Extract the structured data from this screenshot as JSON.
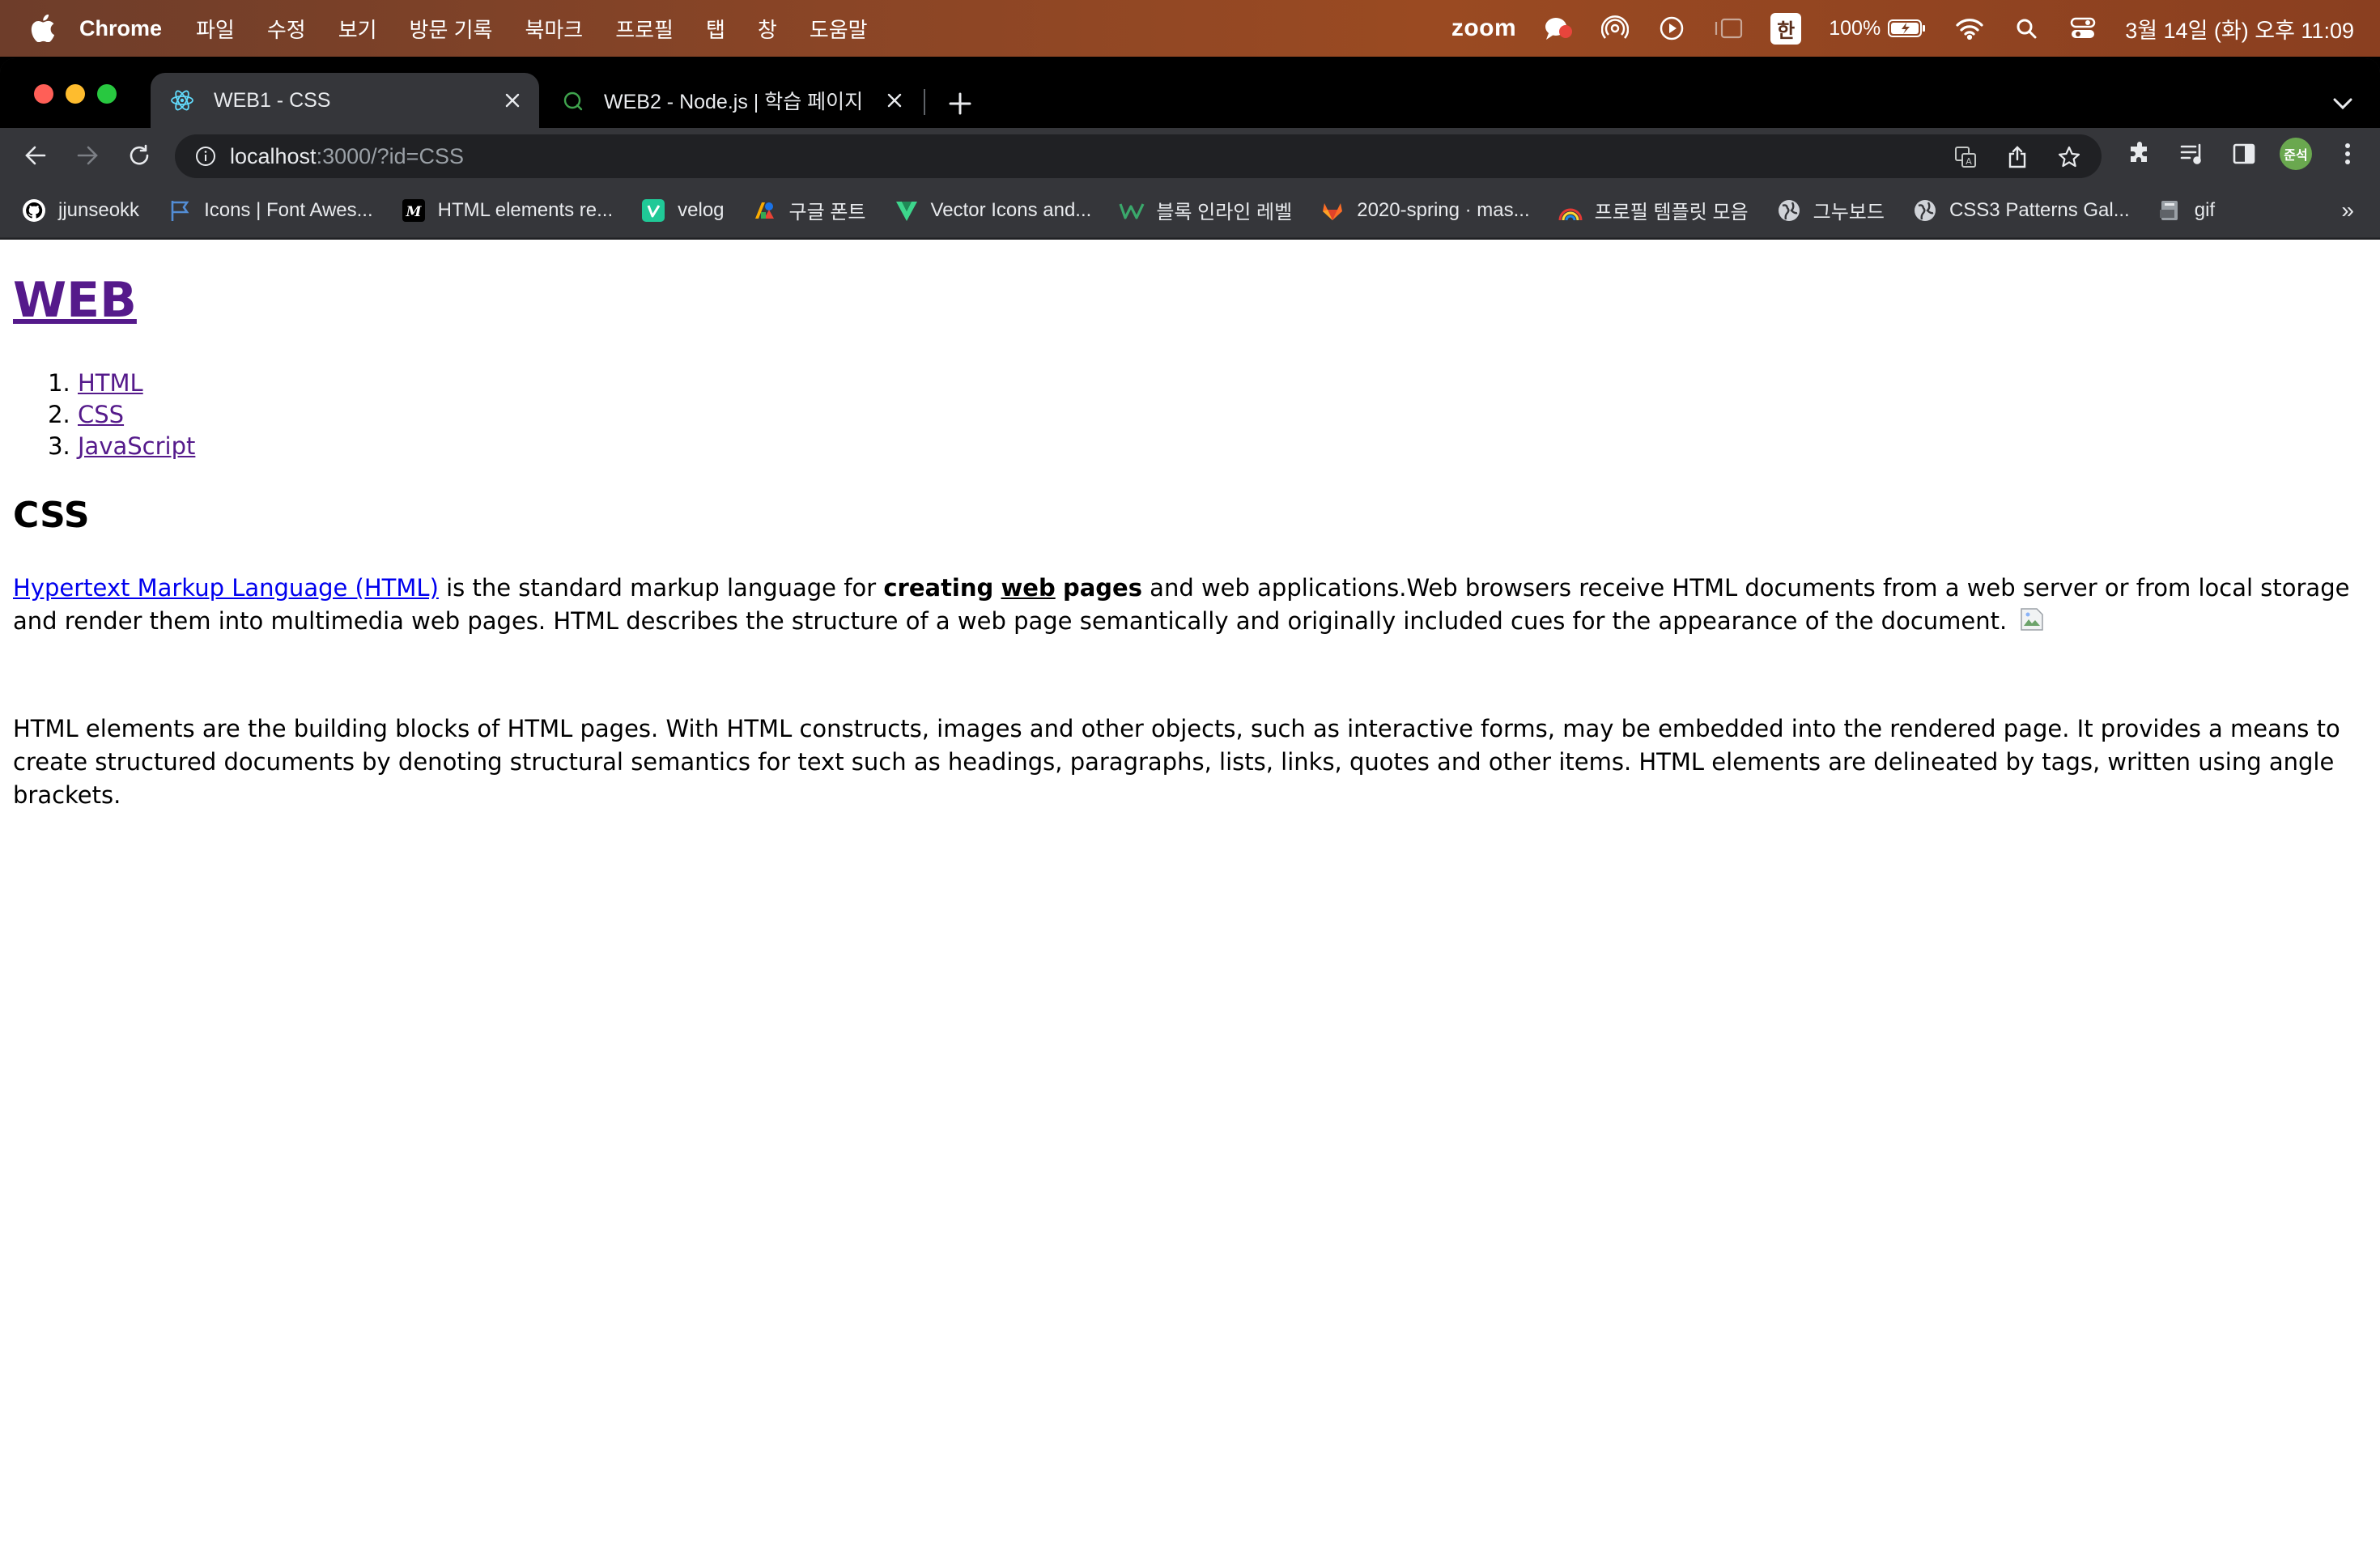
{
  "menubar": {
    "app_name": "Chrome",
    "menus": [
      "파일",
      "수정",
      "보기",
      "방문 기록",
      "북마크",
      "프로필",
      "탭",
      "창",
      "도움말"
    ],
    "zoom_label": "zoom",
    "input_method": "한",
    "battery_percent": "100%",
    "clock": "3월 14일 (화) 오후 11:09"
  },
  "tabs": [
    {
      "title": "WEB1 - CSS",
      "active": true
    },
    {
      "title": "WEB2 - Node.js | 학습 페이지",
      "active": false
    }
  ],
  "omnibox": {
    "host": "localhost",
    "path": ":3000/?id=CSS"
  },
  "avatar_label": "준석",
  "bookmarks": [
    {
      "label": "jjunseokk",
      "icon": "github-icon"
    },
    {
      "label": "Icons | Font Awes...",
      "icon": "flag-icon"
    },
    {
      "label": "HTML elements re...",
      "icon": "mdn-icon"
    },
    {
      "label": "velog",
      "icon": "velog-icon"
    },
    {
      "label": "구글 폰트",
      "icon": "google-fonts-icon"
    },
    {
      "label": "Vector Icons and...",
      "icon": "vector-icon"
    },
    {
      "label": "블록 인라인 레벨",
      "icon": "w-icon"
    },
    {
      "label": "2020-spring · mas...",
      "icon": "gitlab-icon"
    },
    {
      "label": "프로필 템플릿 모음",
      "icon": "rainbow-icon"
    },
    {
      "label": "그누보드",
      "icon": "globe-icon"
    },
    {
      "label": "CSS3 Patterns Gal...",
      "icon": "globe-icon"
    },
    {
      "label": "gif",
      "icon": "gif-icon"
    }
  ],
  "page": {
    "title": "WEB",
    "nav": [
      "HTML",
      "CSS",
      "JavaScript"
    ],
    "section_title": "CSS",
    "para1": {
      "link": "Hypertext Markup Language (HTML)",
      "t1": " is the standard markup language for ",
      "b1": "creating",
      "b2": "web",
      "b3": "pages",
      "t2": " and web applications.Web browsers receive HTML documents from a web server or from local storage and render them into multimedia web pages. HTML describes the structure of a web page semantically and originally included cues for the appearance of the document."
    },
    "para2": "HTML elements are the building blocks of HTML pages. With HTML constructs, images and other objects, such as interactive forms, may be embedded into the rendered page. It provides a means to create structured documents by denoting structural semantics for text such as headings, paragraphs, lists, links, quotes and other items. HTML elements are delineated by tags, written using angle brackets."
  }
}
